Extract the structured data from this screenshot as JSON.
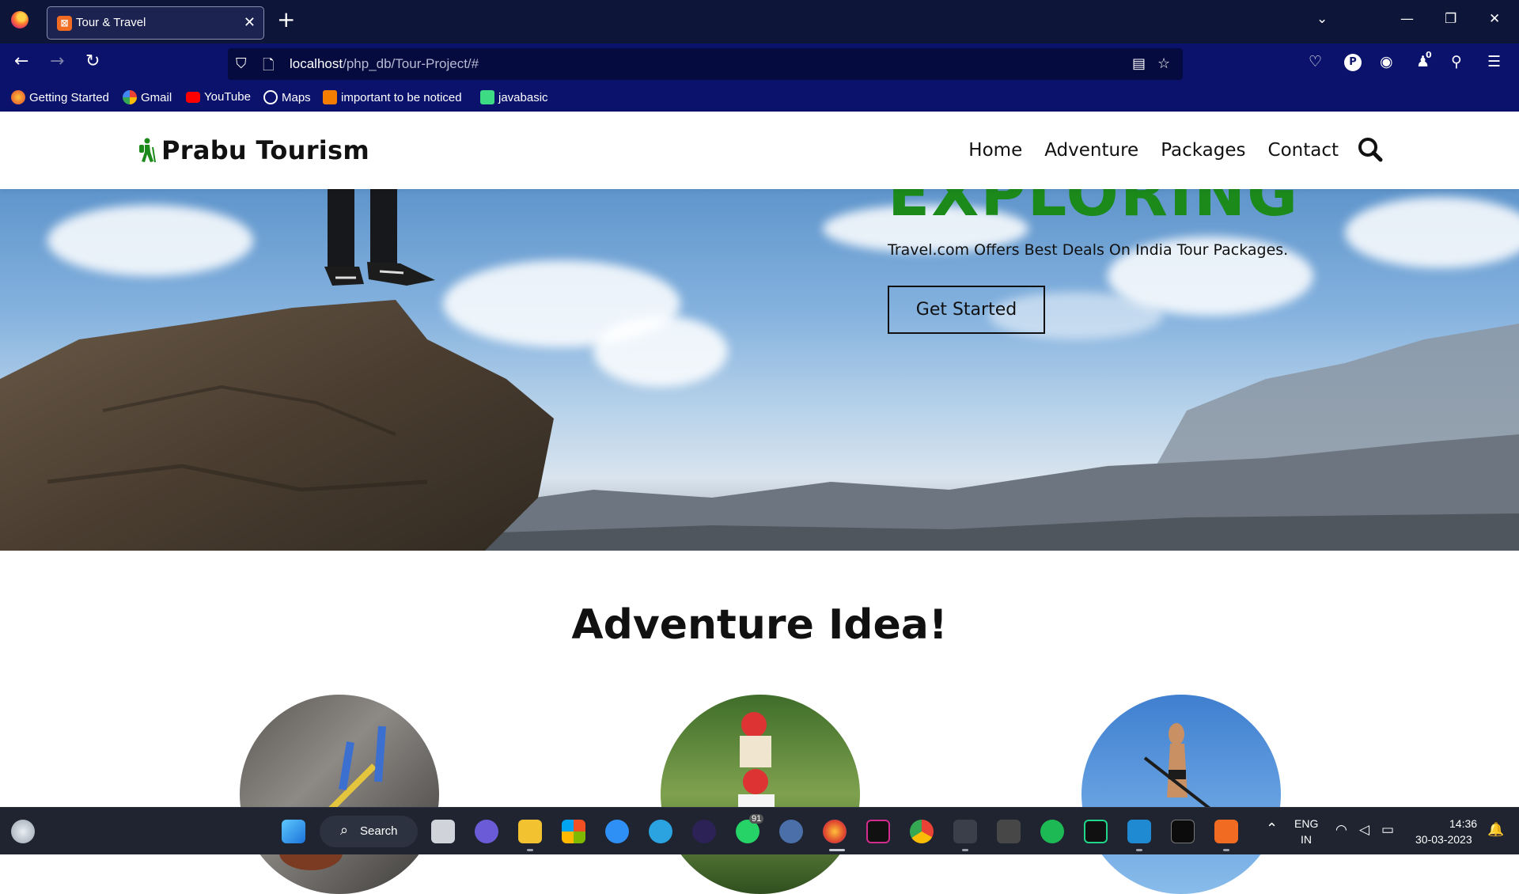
{
  "browser": {
    "tab_title": "Tour & Travel",
    "url_host": "localhost",
    "url_path": "/php_db/Tour-Project/#",
    "bookmarks": [
      "Getting Started",
      "Gmail",
      "YouTube",
      "Maps",
      "important to be noticed",
      "javabasic"
    ],
    "extension_badge": "0",
    "profile_initial": "P"
  },
  "site": {
    "brand": "Prabu Tourism",
    "menu": [
      "Home",
      "Adventure",
      "Packages",
      "Contact"
    ],
    "hero": {
      "heading": "EXPLORING",
      "subtitle": "Travel.com Offers Best Deals On India Tour Packages.",
      "button": "Get Started"
    },
    "section_title": "Adventure Idea!"
  },
  "taskbar": {
    "search_label": "Search",
    "whatsapp_badge": "91",
    "language_top": "ENG",
    "language_bottom": "IN",
    "time": "14:36",
    "date": "30-03-2023"
  },
  "colors": {
    "tabbar": "#0d1538",
    "toolbar": "#0a126b",
    "hero_heading": "#1b8a1b",
    "taskbar": "#1f2430"
  }
}
